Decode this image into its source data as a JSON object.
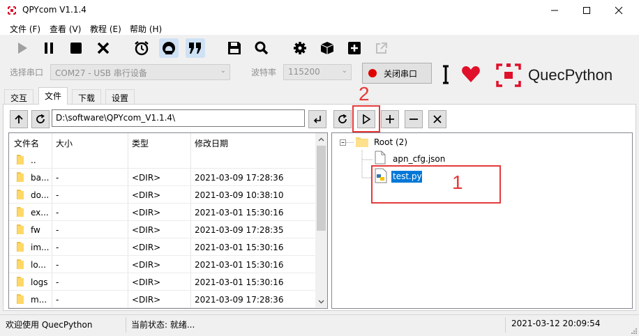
{
  "window": {
    "title": "QPYcom V1.1.4",
    "minimize": "—",
    "maximize": "☐",
    "close": "✕"
  },
  "menu": [
    "文件 (F)",
    "查看 (V)",
    "教程 (E)",
    "帮助 (H)"
  ],
  "toolbar": {
    "icons": [
      "play-icon",
      "pause-icon",
      "stop-icon",
      "close-icon",
      "alarm-clock-icon",
      "gauge-icon",
      "quote-icon",
      "save-icon",
      "search-icon",
      "gear-icon",
      "cube-icon",
      "plus-square-icon",
      "external-link-icon"
    ]
  },
  "port": {
    "port_label": "选择串口",
    "port_value": "COM27 - USB 串行设备",
    "baud_label": "波特率",
    "baud_value": "115200",
    "close_port_label": "关闭串口",
    "brand": "QuecPython"
  },
  "tabs": [
    "交互",
    "文件",
    "下载",
    "设置"
  ],
  "active_tab": "文件",
  "file_browser": {
    "path": "D:\\software\\QPYcom_V1.1.4\\",
    "columns": [
      "文件名",
      "大小",
      "类型",
      "修改日期"
    ],
    "rows": [
      {
        "name": "..",
        "size": "",
        "type": "",
        "date": ""
      },
      {
        "name": "ba...",
        "size": "-",
        "type": "<DIR>",
        "date": "2021-03-09 17:28:36"
      },
      {
        "name": "do...",
        "size": "-",
        "type": "<DIR>",
        "date": "2021-03-09 10:38:10"
      },
      {
        "name": "ex...",
        "size": "-",
        "type": "<DIR>",
        "date": "2021-03-01 15:30:16"
      },
      {
        "name": "fw",
        "size": "-",
        "type": "<DIR>",
        "date": "2021-03-09 17:28:35"
      },
      {
        "name": "im...",
        "size": "-",
        "type": "<DIR>",
        "date": "2021-03-01 15:30:16"
      },
      {
        "name": "lo...",
        "size": "-",
        "type": "<DIR>",
        "date": "2021-03-01 15:30:16"
      },
      {
        "name": "logs",
        "size": "-",
        "type": "<DIR>",
        "date": "2021-03-01 15:30:16"
      },
      {
        "name": "m...",
        "size": "-",
        "type": "<DIR>",
        "date": "2021-03-09 17:28:36"
      }
    ]
  },
  "device_tree": {
    "root": "Root (2)",
    "files": [
      "apn_cfg.json",
      "test.py"
    ],
    "selected": "test.py"
  },
  "annotations": [
    "1",
    "2"
  ],
  "status": {
    "welcome": "欢迎使用 QuecPython",
    "state": "当前状态: 就绪...",
    "datetime": "2021-03-12 20:09:54"
  },
  "colors": {
    "accent": "#0078d7",
    "annotation": "#e5393a",
    "brand_red": "#e0102a",
    "active_tool": "#cfe1f4"
  }
}
